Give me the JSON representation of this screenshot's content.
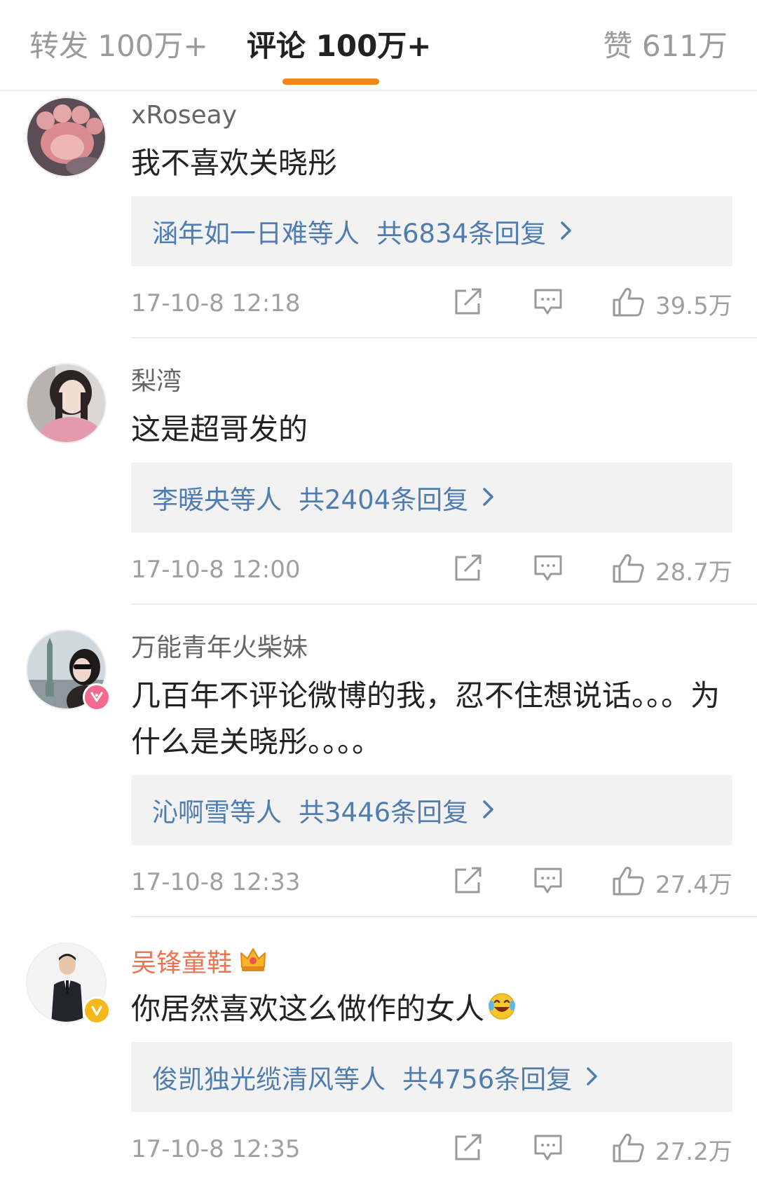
{
  "tabs": {
    "forward": "转发 100万+",
    "comments": "评论 100万+",
    "likes": "赞 611万",
    "active_color": "#f08519"
  },
  "colors": {
    "link": "#507daf",
    "vip_name": "#eb7350",
    "meta": "#a0a0a0"
  },
  "icons": {
    "share": "share-icon",
    "comment": "comment-icon",
    "like": "thumbs-up-icon",
    "chevron": "chevron-right-icon"
  },
  "comments": [
    {
      "user": "xRoseay",
      "text": "我不喜欢关晓彤",
      "reply_names": "涵年如一日难等人",
      "reply_count": "共6834条回复",
      "time": "17-10-8 12:18",
      "likes": "39.5万"
    },
    {
      "user": "梨湾",
      "text": "这是超哥发的",
      "reply_names": "李暖央等人",
      "reply_count": "共2404条回复",
      "time": "17-10-8 12:00",
      "likes": "28.7万"
    },
    {
      "user": "万能青年火柴妹",
      "text": "几百年不评论微博的我，忍不住想说话。。。为什么是关晓彤。。。。",
      "reply_names": "沁啊雪等人",
      "reply_count": "共3446条回复",
      "time": "17-10-8 12:33",
      "likes": "27.4万",
      "badge": "vip-pink-badge-icon"
    },
    {
      "user": "吴锋童鞋",
      "text": "你居然喜欢这么做作的女人",
      "emoji": "crying-laughing-emoji",
      "reply_names": "俊凯独光缆清风等人",
      "reply_count": "共4756条回复",
      "time": "17-10-8 12:35",
      "likes": "27.2万",
      "badge": "verified-yellow-badge-icon",
      "crown": "crown-icon"
    }
  ]
}
